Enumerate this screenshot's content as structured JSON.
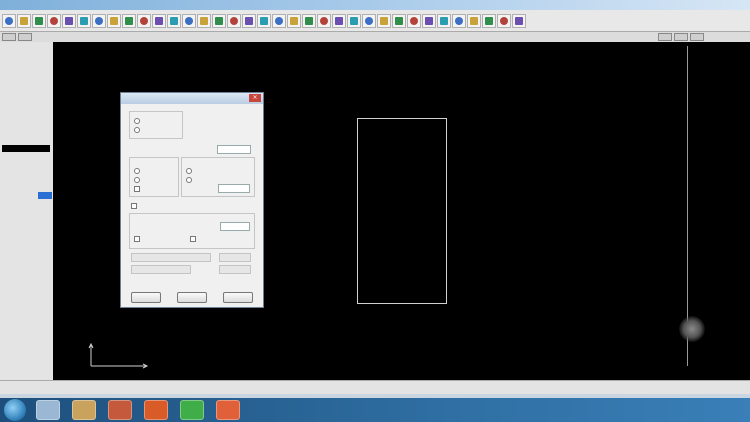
{
  "window": {
    "title": "",
    "accent": "#7fb0da"
  },
  "toolbar": {
    "icons": [
      "new-file-icon",
      "open-icon",
      "save-icon",
      "print-icon",
      "undo-icon",
      "redo-icon",
      "cut-icon",
      "copy-icon",
      "paste-icon",
      "line-icon",
      "rect-icon",
      "circle-icon",
      "arc-icon",
      "polyline-icon",
      "text-icon",
      "dim-icon",
      "zoom-icon",
      "pan-icon",
      "layer-icon",
      "color-icon",
      "grid-icon",
      "snap-icon",
      "ortho-icon",
      "measure-icon",
      "hatch-icon",
      "block-icon",
      "insert-icon",
      "array-icon",
      "mirror-icon",
      "rotate-icon",
      "scale-icon",
      "trim-icon",
      "extend-icon",
      "fillet-icon",
      "help-icon"
    ]
  },
  "sidebar": {
    "items": [
      "",
      "",
      "",
      "",
      "",
      "",
      "",
      "",
      "",
      "",
      "",
      "",
      "",
      "",
      "",
      "",
      "",
      "",
      "",
      "",
      "",
      ""
    ]
  },
  "canvas": {
    "background": "#000000",
    "shape_color": "#d0d0d0"
  },
  "dialog": {
    "title": "",
    "close": "×",
    "buttons": [
      "",
      "",
      ""
    ],
    "fields": [
      "",
      "",
      "",
      "",
      "",
      "",
      ""
    ]
  },
  "status": {
    "items": [
      "",
      "",
      "",
      ""
    ]
  },
  "taskbar": {
    "apps": [
      "explorer-icon",
      "media-icon",
      "folder-icon",
      "cad-icon",
      "browser-icon",
      "paint-icon"
    ],
    "colors": [
      "#9ab8d4",
      "#c9a35e",
      "#c45a3b",
      "#d95b28",
      "#3fae49",
      "#e0603a"
    ]
  }
}
